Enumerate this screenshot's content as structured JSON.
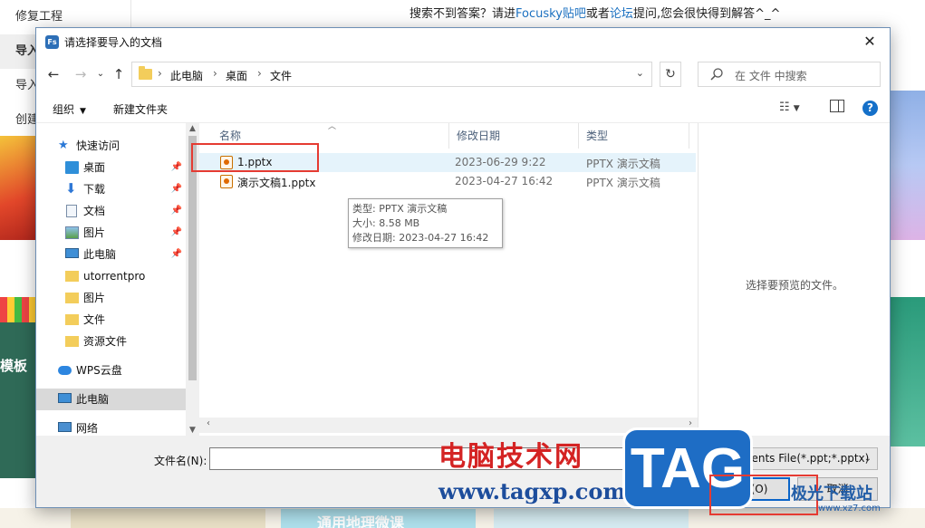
{
  "background": {
    "menu": [
      "修复工程",
      "导入",
      "导入",
      "创建"
    ],
    "help_text": {
      "pre": "搜索不到答案？请进",
      "link1": "Focusky贴吧",
      "mid": "或者",
      "link2": "论坛",
      "post": "提问,您会很快得到解答^_^"
    },
    "thumb_caption": "模板",
    "bottom_caption": "通用地理微课"
  },
  "dialog": {
    "title": "请选择要导入的文档",
    "app_icon_text": "Fs",
    "breadcrumb": [
      "此电脑",
      "桌面",
      "文件"
    ],
    "search_placeholder": "在 文件 中搜索",
    "toolbar": {
      "organize": "组织",
      "new_folder": "新建文件夹"
    },
    "nav": {
      "items": [
        {
          "label": "快速访问",
          "icon": "star-icon",
          "pinned": false
        },
        {
          "label": "桌面",
          "icon": "desktop-icon",
          "pinned": true
        },
        {
          "label": "下载",
          "icon": "download-icon",
          "pinned": true
        },
        {
          "label": "文档",
          "icon": "document-icon",
          "pinned": true
        },
        {
          "label": "图片",
          "icon": "picture-icon",
          "pinned": true
        },
        {
          "label": "此电脑",
          "icon": "computer-icon",
          "pinned": true
        },
        {
          "label": "utorrentpro",
          "icon": "folder-icon",
          "pinned": false
        },
        {
          "label": "图片",
          "icon": "folder-icon",
          "pinned": false
        },
        {
          "label": "文件",
          "icon": "folder-icon",
          "pinned": false
        },
        {
          "label": "资源文件",
          "icon": "folder-icon",
          "pinned": false
        },
        {
          "label": "WPS云盘",
          "icon": "cloud-icon",
          "pinned": false
        },
        {
          "label": "此电脑",
          "icon": "computer-icon",
          "pinned": false,
          "selected": true
        },
        {
          "label": "网络",
          "icon": "network-icon",
          "pinned": false
        }
      ]
    },
    "columns": {
      "name": "名称",
      "date": "修改日期",
      "type": "类型"
    },
    "files": [
      {
        "name": "1.pptx",
        "date": "2023-06-29 9:22",
        "type": "PPTX 演示文稿"
      },
      {
        "name": "演示文稿1.pptx",
        "date": "2023-04-27 16:42",
        "type": "PPTX 演示文稿"
      }
    ],
    "tooltip": {
      "type": "类型: PPTX 演示文稿",
      "size": "大小: 8.58 MB",
      "modified": "修改日期: 2023-04-27 16:42"
    },
    "preview_text": "选择要预览的文件。",
    "filename_label": "文件名(N):",
    "filename_value": "",
    "filetype": "Documents File(*.ppt;*.pptx)",
    "open_button": "打开(O)",
    "cancel_button": "取消"
  },
  "watermark": {
    "site_name": "电脑技术网",
    "site_url": "www.tagxp.com",
    "logo_text": "TAG",
    "partner": "极光下载站",
    "partner_url": "www.xz7.com"
  },
  "colors": {
    "accent": "#1570c9",
    "highlight": "#e5f3fb",
    "annotation": "#e53b32"
  }
}
